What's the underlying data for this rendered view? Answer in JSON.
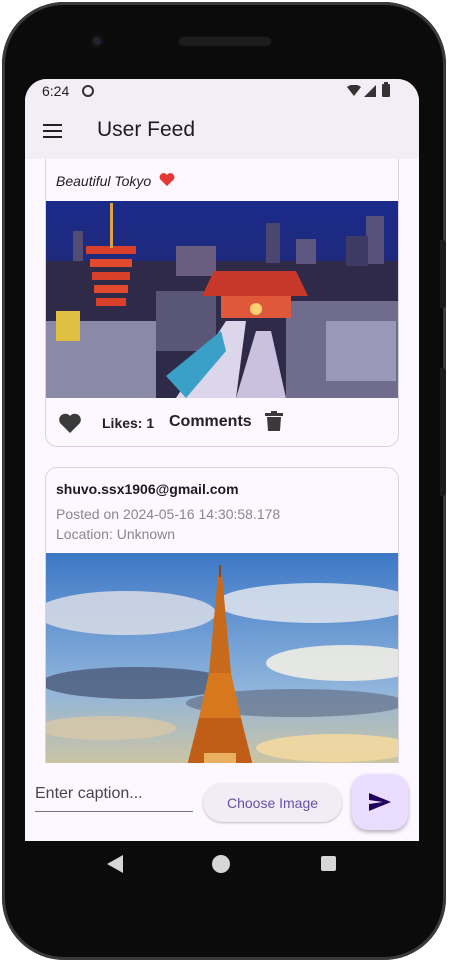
{
  "status_bar": {
    "time": "6:24"
  },
  "app_bar": {
    "title": "User Feed",
    "menu_icon": "hamburger-menu-icon"
  },
  "posts": [
    {
      "caption": "Beautiful Tokyo ",
      "caption_emoji": "❤️",
      "image": "tokyo-night-pagoda",
      "likes_label": "Likes: 1",
      "comments_label": "Comments",
      "like_icon": "heart-icon",
      "delete_icon": "trash-icon"
    },
    {
      "user": "shuvo.ssx1906@gmail.com",
      "posted": "Posted on 2024-05-16 14:30:58.178",
      "location": "Location: Unknown",
      "image": "eiffel-tower-sunset"
    }
  ],
  "composer": {
    "caption_placeholder": "Enter caption...",
    "choose_image_label": "Choose Image",
    "send_icon": "send-icon"
  },
  "colors": {
    "accent": "#6750a4",
    "fab": "#eaddff",
    "app_bar": "#f3eef6",
    "surface": "#fdf7ff"
  }
}
